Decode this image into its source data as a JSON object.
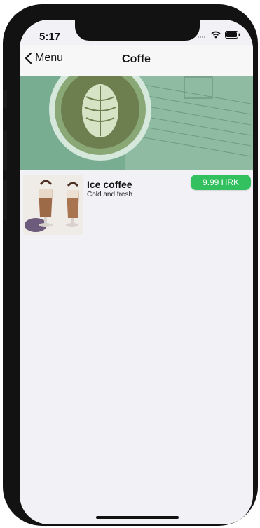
{
  "status_bar": {
    "time": "5:17"
  },
  "nav": {
    "back_label": "Menu",
    "title": "Coffe"
  },
  "products": [
    {
      "name": "Ice coffee",
      "description": "Cold and fresh",
      "price": "9.99 HRK"
    }
  ],
  "colors": {
    "accent_green": "#33c15f",
    "hero_tint": "#6fa68a",
    "screen_background": "#f2f1f6"
  },
  "icons": [
    "chevron-left-icon",
    "signal-icon",
    "wifi-icon",
    "battery-icon"
  ]
}
